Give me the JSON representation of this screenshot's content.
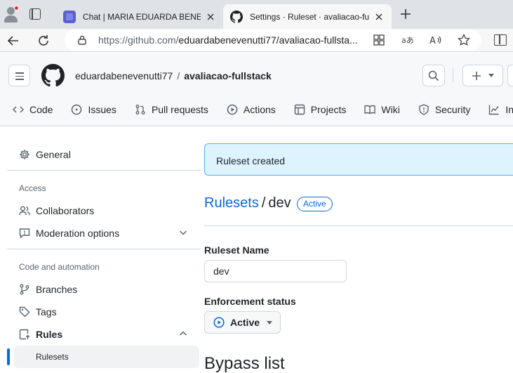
{
  "browser": {
    "tabs": [
      {
        "title": "Chat | MARIA EDUARDA BENEVENUTTI",
        "active": false
      },
      {
        "title": "Settings · Ruleset · avaliacao-fullstack",
        "active": true
      }
    ],
    "url_host": "https://github.com/",
    "url_path": "eduardabenevenutti77/avaliacao-fullsta..."
  },
  "header": {
    "owner": "eduardabenevenutti77",
    "separator": "/",
    "repo": "avaliacao-fullstack"
  },
  "repo_nav": [
    {
      "label": "Code",
      "icon": "code-icon"
    },
    {
      "label": "Issues",
      "icon": "issue-icon"
    },
    {
      "label": "Pull requests",
      "icon": "pull-request-icon"
    },
    {
      "label": "Actions",
      "icon": "play-icon"
    },
    {
      "label": "Projects",
      "icon": "table-icon"
    },
    {
      "label": "Wiki",
      "icon": "book-icon"
    },
    {
      "label": "Security",
      "icon": "shield-icon"
    },
    {
      "label": "Insig",
      "icon": "graph-icon"
    }
  ],
  "sidebar": {
    "general": "General",
    "access_heading": "Access",
    "collaborators": "Collaborators",
    "moderation": "Moderation options",
    "code_heading": "Code and automation",
    "branches": "Branches",
    "tags": "Tags",
    "rules": "Rules",
    "rulesets": "Rulesets"
  },
  "main": {
    "flash": "Ruleset created",
    "breadcrumb_link": "Rulesets",
    "breadcrumb_sep": "/",
    "ruleset_name": "dev",
    "status_badge": "Active",
    "name_label": "Ruleset Name",
    "name_value": "dev",
    "enforcement_label": "Enforcement status",
    "enforcement_value": "Active",
    "bypass_heading": "Bypass list"
  },
  "colors": {
    "accent": "#0969da",
    "flash_bg": "#ddf4ff",
    "flash_border": "#54aeff"
  }
}
